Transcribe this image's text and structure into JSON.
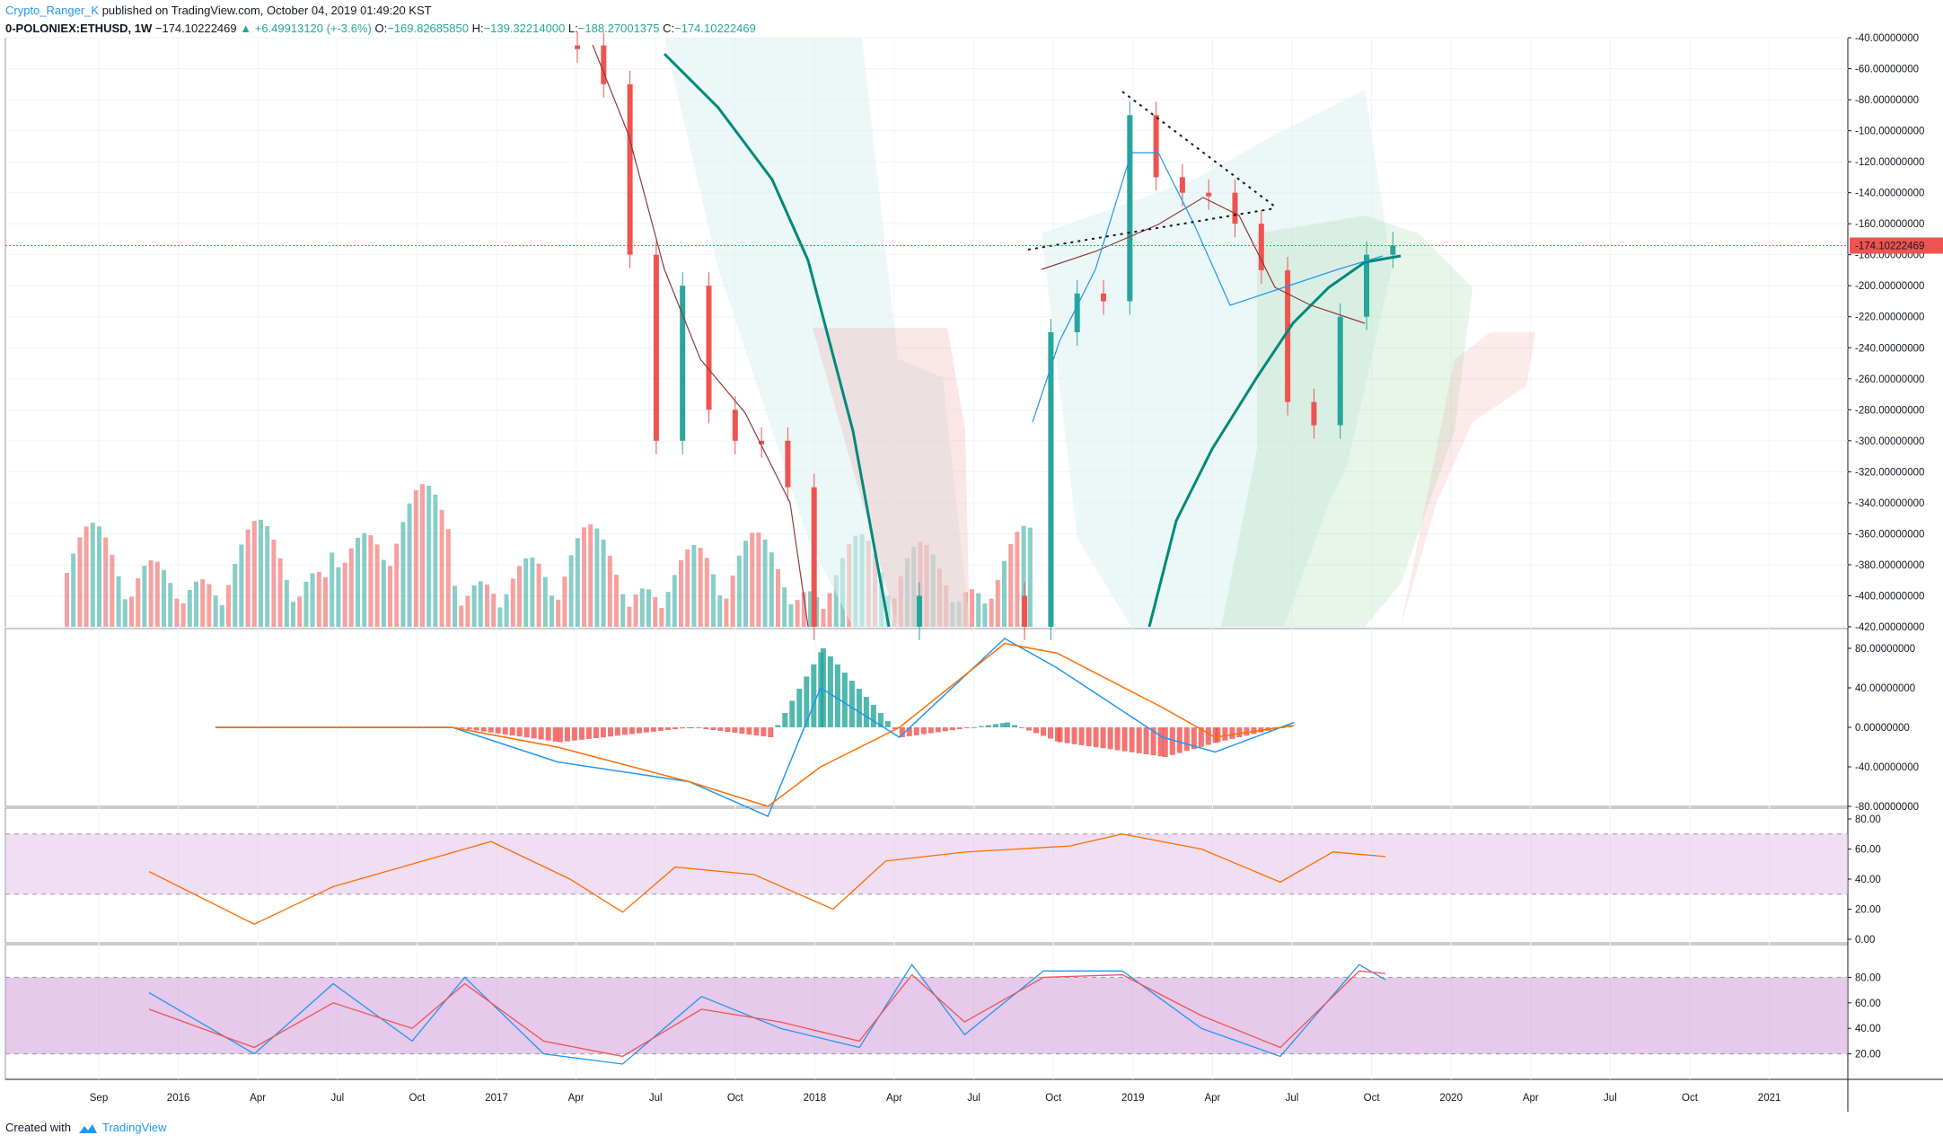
{
  "header": {
    "author": "Crypto_Ranger_K",
    "published": "published on TradingView.com, October 04, 2019 01:49:20 KST",
    "symbol": "0-POLONIEX:ETHUSD, 1W",
    "last": "−174.10222469",
    "change": "+6.49913120 (+-3.6%)",
    "o_label": "O:",
    "o_value": "−169.82685850",
    "h_label": "H:",
    "h_value": "−139.32214000",
    "l_label": "L:",
    "l_value": "−188.27001375",
    "c_label": "C:",
    "c_value": "−174.10222469"
  },
  "footer": {
    "created_with": "Created with",
    "brand": "TradingView"
  },
  "colors": {
    "up": "#26a69a",
    "down": "#ef5350",
    "cloud_green": "#a5d6a7",
    "cloud_red": "#ef9a9a",
    "ema_thick": "#00897b",
    "macd_line": "#2196f3",
    "signal_line": "#ff6d00",
    "rsi_band": "#e1bee7",
    "stoch_band": "#ce93d8",
    "price_label": "#ef5350"
  },
  "chart_data": [
    {
      "type": "candlestick",
      "pane": "price",
      "note_units": "inverted-price axis",
      "ylim": [
        -420,
        -40
      ],
      "y_ticks": [
        "-40.00000000",
        "-60.00000000",
        "-80.00000000",
        "-100.00000000",
        "-120.00000000",
        "-140.00000000",
        "-160.00000000",
        "-180.00000000",
        "-200.00000000",
        "-220.00000000",
        "-240.00000000",
        "-260.00000000",
        "-280.00000000",
        "-300.00000000",
        "-320.00000000",
        "-340.00000000",
        "-360.00000000",
        "-380.00000000",
        "-400.00000000",
        "-420.00000000"
      ],
      "last_price_label": "-174.10222469",
      "last_price": -174.1,
      "close_series": [
        {
          "x": "2017-03",
          "y": -45
        },
        {
          "x": "2017-04",
          "y": -70
        },
        {
          "x": "2017-05",
          "y": -180
        },
        {
          "x": "2017-06",
          "y": -300
        },
        {
          "x": "2017-07",
          "y": -200
        },
        {
          "x": "2017-08",
          "y": -280
        },
        {
          "x": "2017-09",
          "y": -300
        },
        {
          "x": "2017-10",
          "y": -300
        },
        {
          "x": "2017-11",
          "y": -330
        },
        {
          "x": "2017-12",
          "y": -420
        },
        {
          "x": "2018-04",
          "y": -400
        },
        {
          "x": "2018-08",
          "y": -420
        },
        {
          "x": "2018-09",
          "y": -230
        },
        {
          "x": "2018-10",
          "y": -205
        },
        {
          "x": "2018-11",
          "y": -210
        },
        {
          "x": "2018-12",
          "y": -90
        },
        {
          "x": "2019-01",
          "y": -130
        },
        {
          "x": "2019-02",
          "y": -140
        },
        {
          "x": "2019-03",
          "y": -140
        },
        {
          "x": "2019-04",
          "y": -160
        },
        {
          "x": "2019-05",
          "y": -190
        },
        {
          "x": "2019-06",
          "y": -275
        },
        {
          "x": "2019-07",
          "y": -290
        },
        {
          "x": "2019-08",
          "y": -220
        },
        {
          "x": "2019-09",
          "y": -180
        },
        {
          "x": "2019-10",
          "y": -174
        }
      ],
      "volume_visible": true
    },
    {
      "type": "bar",
      "pane": "macd",
      "ylim": [
        -80,
        100
      ],
      "y_ticks": [
        "80.00000000",
        "40.00000000",
        "0.00000000",
        "-40.00000000",
        "-80.00000000"
      ],
      "series": [
        {
          "values_x": [
            "2016-05",
            "2017-02",
            "2017-06",
            "2017-11",
            "2018-02",
            "2018-04",
            "2018-07",
            "2018-11",
            "2019-01",
            "2019-05",
            "2019-07",
            "2019-10"
          ],
          "macd": [
            0,
            0,
            -35,
            -55,
            -90,
            40,
            -10,
            90,
            60,
            -10,
            -25,
            5
          ],
          "signal": [
            0,
            0,
            -20,
            -55,
            -80,
            -40,
            0,
            85,
            75,
            20,
            -10,
            2
          ]
        }
      ]
    },
    {
      "type": "line",
      "pane": "rsi",
      "ylim": [
        0,
        80
      ],
      "y_ticks": [
        "80.00",
        "60.00",
        "40.00",
        "20.00",
        "0.00"
      ],
      "band": [
        30,
        70
      ],
      "values_x": [
        "2015-11",
        "2016-03",
        "2016-06",
        "2016-10",
        "2016-12",
        "2017-03",
        "2017-05",
        "2017-07",
        "2017-10",
        "2018-01",
        "2018-03",
        "2018-06",
        "2018-10",
        "2018-12",
        "2019-03",
        "2019-06",
        "2019-08",
        "2019-10"
      ],
      "values": [
        45,
        10,
        35,
        55,
        65,
        40,
        18,
        48,
        43,
        20,
        52,
        58,
        62,
        70,
        60,
        38,
        58,
        55
      ]
    },
    {
      "type": "line",
      "pane": "stoch",
      "ylim": [
        0,
        100
      ],
      "y_ticks": [
        "80.00",
        "60.00",
        "40.00",
        "20.00"
      ],
      "band": [
        20,
        80
      ],
      "values_x": [
        "2015-11",
        "2016-03",
        "2016-06",
        "2016-09",
        "2016-11",
        "2017-02",
        "2017-05",
        "2017-08",
        "2017-11",
        "2018-02",
        "2018-04",
        "2018-06",
        "2018-09",
        "2018-12",
        "2019-03",
        "2019-06",
        "2019-09",
        "2019-10"
      ],
      "k": [
        68,
        20,
        75,
        30,
        80,
        20,
        12,
        65,
        40,
        25,
        90,
        35,
        85,
        85,
        40,
        18,
        90,
        78
      ],
      "d": [
        55,
        25,
        60,
        40,
        75,
        30,
        18,
        55,
        45,
        30,
        82,
        45,
        80,
        82,
        50,
        25,
        85,
        83
      ]
    }
  ],
  "time_axis": [
    "Sep",
    "2016",
    "Apr",
    "Jul",
    "Oct",
    "2017",
    "Apr",
    "Jul",
    "Oct",
    "2018",
    "Apr",
    "Jul",
    "Oct",
    "2019",
    "Apr",
    "Jul",
    "Oct",
    "2020",
    "Apr",
    "Jul",
    "Oct",
    "2021"
  ]
}
